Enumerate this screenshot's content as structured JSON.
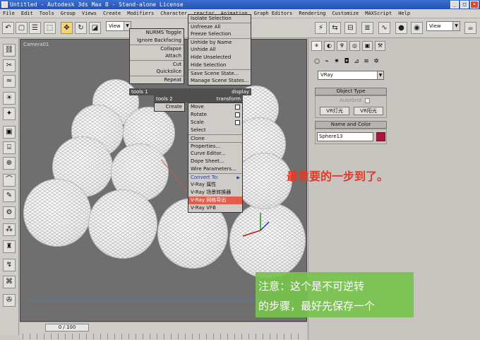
{
  "window": {
    "title": "Untitled - Autodesk 3ds Max 8 - Stand-alone License",
    "controls": [
      "_",
      "□",
      "×"
    ]
  },
  "menubar": [
    "File",
    "Edit",
    "Tools",
    "Group",
    "Views",
    "Create",
    "Modifiers",
    "Character",
    "reactor",
    "Animation",
    "Graph Editors",
    "Rendering",
    "Customize",
    "MAXScript",
    "Help"
  ],
  "toolbar": {
    "view_combo_left": "View",
    "view_combo_right": "View"
  },
  "viewport": {
    "label": "Camera01"
  },
  "timeline": {
    "frame": "0 / 100"
  },
  "quad_menu": {
    "top_left": [
      "NURMS Toggle",
      "Ignore Backfacing",
      "Collapse",
      "Attach",
      "Cut",
      "Quickslice",
      "Repeat"
    ],
    "top_right": [
      "Isolate Selection",
      "Unfreeze All",
      "Freeze Selection",
      "Unhide by Name",
      "Unhide All",
      "Hide Unselected",
      "Hide Selection",
      "Save Scene State...",
      "Manage Scene States..."
    ],
    "header_tools1": "tools 1",
    "header_display": "display",
    "header_tools2": "tools 2",
    "header_transform": "transform",
    "bottom_left": [
      "Create"
    ],
    "bottom_right": [
      "Move",
      "Rotate",
      "Scale",
      "Select",
      "Clone",
      "Properties...",
      "Curve Editor...",
      "Dope Sheet...",
      "Wire Parameters...",
      "Convert To:",
      "V-Ray 属性",
      "V-Ray 场景转换器",
      "V-Ray 网格导出",
      "V-Ray VFB"
    ]
  },
  "command_panel": {
    "renderer_combo": "VRay",
    "object_type_title": "Object Type",
    "autogrid_label": "AutoGrid",
    "btn_light": "VR灯光",
    "btn_sun": "VR阳光",
    "name_color_title": "Name and Color",
    "object_name": "Sphere13",
    "object_color": "#b0143e"
  },
  "annotations": {
    "red_note": "最重要的一步到了。",
    "green_line1": "注意：这个是不可逆转",
    "green_line2": "的步骤，最好先保存一个"
  }
}
